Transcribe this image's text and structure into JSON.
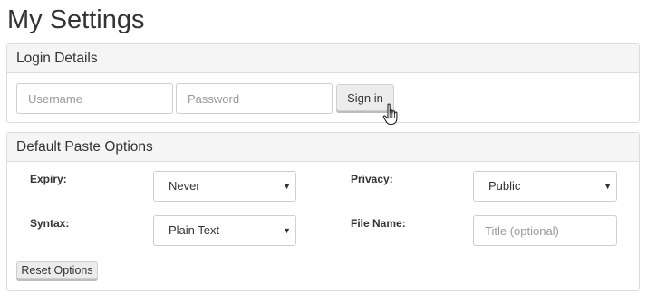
{
  "page": {
    "title": "My Settings"
  },
  "login": {
    "heading": "Login Details",
    "username_placeholder": "Username",
    "password_placeholder": "Password",
    "signin_label": "Sign in"
  },
  "paste": {
    "heading": "Default Paste Options",
    "expiry_label": "Expiry:",
    "expiry_value": "Never",
    "privacy_label": "Privacy:",
    "privacy_value": "Public",
    "syntax_label": "Syntax:",
    "syntax_value": "Plain Text",
    "filename_label": "File Name:",
    "filename_placeholder": "Title (optional)",
    "reset_label": "Reset Options"
  },
  "icons": {
    "caret": "caret-down-icon",
    "cursor": "hand-pointer-icon"
  }
}
